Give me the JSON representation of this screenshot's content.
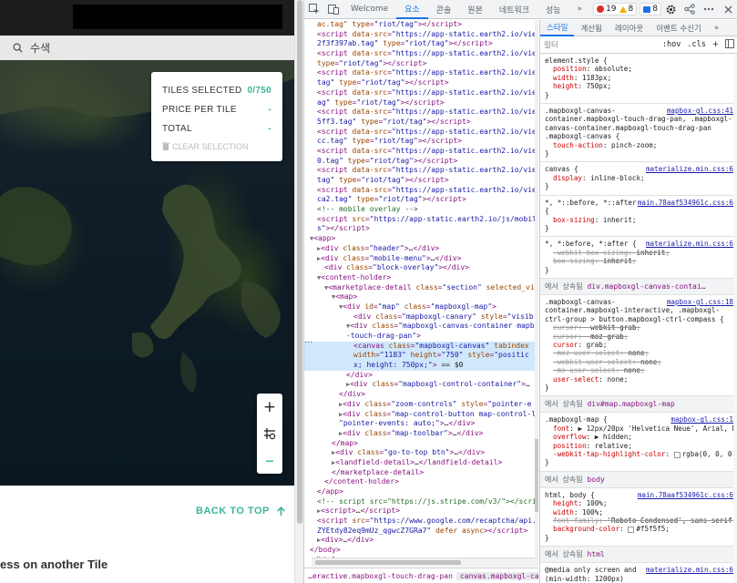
{
  "page": {
    "search_placeholder": "수색",
    "stats": {
      "tiles_selected_label": "TILES SELECTED",
      "tiles_selected_value": "0/750",
      "price_label": "PRICE PER TILE",
      "price_value": "-",
      "total_label": "TOTAL",
      "total_value": "-",
      "clear_label": "CLEAR SELECTION"
    },
    "zoom": {
      "plus": "+",
      "locate": "⌖",
      "minus": "–"
    },
    "back_to_top": "BACK TO TOP",
    "bottom_text": "ess on another Tile"
  },
  "devtools": {
    "tabs": [
      "Welcome",
      "요소",
      "콘솔",
      "원본",
      "네트워크",
      "성능",
      "»"
    ],
    "active_tab": "요소",
    "badges": {
      "errors": "19",
      "warnings": "8",
      "info": "8"
    },
    "elements_lines": [
      {
        "html": "<span class='an'>ac.tag\"</span> <span class='an'>type</span>=<span class='av'>\"riot/tag\"</span>&gt;&lt;/script&gt;",
        "i": 1
      },
      {
        "html": "&lt;script <span class='an'>data-src</span>=<span class='av'>\"https://app-static.earth2.io/vie</span>",
        "i": 1
      },
      {
        "html": "<span class='av'>2f3f397ab.tag\"</span> <span class='an'>type</span>=<span class='av'>\"riot/tag\"</span>&gt;&lt;/script&gt;",
        "i": 1
      },
      {
        "html": "&lt;script <span class='an'>data-src</span>=<span class='av'>\"https://app-static.earth2.io/vie</span>",
        "i": 1
      },
      {
        "html": "<span class='an'>type</span>=<span class='av'>\"riot/tag\"</span>&gt;&lt;/script&gt;",
        "i": 1
      },
      {
        "html": "&lt;script <span class='an'>data-src</span>=<span class='av'>\"https://app-static.earth2.io/vie</span>",
        "i": 1
      },
      {
        "html": "<span class='av'>tag\"</span> <span class='an'>type</span>=<span class='av'>\"riot/tag\"</span>&gt;&lt;/script&gt;",
        "i": 1
      },
      {
        "html": "&lt;script <span class='an'>data-src</span>=<span class='av'>\"https://app-static.earth2.io/vie</span>",
        "i": 1
      },
      {
        "html": "<span class='av'>ag\"</span> <span class='an'>type</span>=<span class='av'>\"riot/tag\"</span>&gt;&lt;/script&gt;",
        "i": 1
      },
      {
        "html": "&lt;script <span class='an'>data-src</span>=<span class='av'>\"https://app-static.earth2.io/vie</span>",
        "i": 1
      },
      {
        "html": "<span class='av'>5ff3.tag\"</span> <span class='an'>type</span>=<span class='av'>\"riot/tag\"</span>&gt;&lt;/script&gt;",
        "i": 1
      },
      {
        "html": "&lt;script <span class='an'>data-src</span>=<span class='av'>\"https://app-static.earth2.io/vie</span>",
        "i": 1
      },
      {
        "html": "<span class='av'>cc.tag\"</span> <span class='an'>type</span>=<span class='av'>\"riot/tag\"</span>&gt;&lt;/script&gt;",
        "i": 1
      },
      {
        "html": "&lt;script <span class='an'>data-src</span>=<span class='av'>\"https://app-static.earth2.io/vie</span>",
        "i": 1
      },
      {
        "html": "<span class='av'>0.tag\"</span> <span class='an'>type</span>=<span class='av'>\"riot/tag\"</span>&gt;&lt;/script&gt;",
        "i": 1
      },
      {
        "html": "&lt;script <span class='an'>data-src</span>=<span class='av'>\"https://app-static.earth2.io/vie</span>",
        "i": 1
      },
      {
        "html": "<span class='av'>tag\"</span> <span class='an'>type</span>=<span class='av'>\"riot/tag\"</span>&gt;&lt;/script&gt;",
        "i": 1
      },
      {
        "html": "&lt;script <span class='an'>data-src</span>=<span class='av'>\"https://app-static.earth2.io/vie</span>",
        "i": 1
      },
      {
        "html": "<span class='av'>ca2.tag\"</span> <span class='an'>type</span>=<span class='av'>\"riot/tag\"</span>&gt;&lt;/script&gt;",
        "i": 1
      },
      {
        "html": "<span class='cm'>&lt;!-- mobile overlay --&gt;</span>",
        "i": 1
      },
      {
        "html": "&lt;script <span class='an'>src</span>=<span class='av'>\"https://app-static.earth2.io/js/mobile</span>",
        "i": 1
      },
      {
        "html": "<span class='av'>s\"</span>&gt;&lt;/script&gt;",
        "i": 1
      },
      {
        "html": "<span class='arrow'>▼</span>&lt;app&gt;",
        "i": 0
      },
      {
        "html": "<span class='arrow'>▶</span>&lt;div <span class='an'>class</span>=<span class='av'>\"header\"</span>&gt;<span class='tx'>…</span>&lt;/div&gt;",
        "i": 1
      },
      {
        "html": "<span class='arrow'>▶</span>&lt;div <span class='an'>class</span>=<span class='av'>\"mobile-menu\"</span>&gt;<span class='tx'>…</span>&lt;/div&gt;",
        "i": 1
      },
      {
        "html": "&lt;div <span class='an'>class</span>=<span class='av'>\"block-overlay\"</span>&gt;&lt;/div&gt;",
        "i": 2
      },
      {
        "html": "<span class='arrow'>▼</span>&lt;content-holder&gt;",
        "i": 1
      },
      {
        "html": "<span class='arrow'>▼</span>&lt;marketplace-detail <span class='an'>class</span>=<span class='av'>\"section\"</span> <span class='an'>selected_vi</span>",
        "i": 2
      },
      {
        "html": "<span class='arrow'>▼</span>&lt;map&gt;",
        "i": 3
      },
      {
        "html": "<span class='arrow'>▼</span>&lt;div <span class='an'>id</span>=<span class='av'>\"map\"</span> <span class='an'>class</span>=<span class='av'>\"mapboxgl-map\"</span>&gt;",
        "i": 4
      },
      {
        "html": "&lt;div <span class='an'>class</span>=<span class='av'>\"mapboxgl-canary\"</span> <span class='an'>style</span>=<span class='av'>\"visib</span>",
        "i": 6
      },
      {
        "html": "<span class='arrow'>▼</span>&lt;div <span class='an'>class</span>=<span class='av'>\"mapboxgl-canvas-container mapb</span>",
        "i": 5
      },
      {
        "html": "<span class='av'>-touch-drag-pan\"</span>&gt;",
        "i": 5
      },
      {
        "html": "&lt;canvas <span class='an'>class</span>=<span class='av'>\"mapboxgl-canvas\"</span> <span class='an'>tabindex</span>",
        "i": 6,
        "sel": true
      },
      {
        "html": "<span class='an'>width</span>=<span class='av'>\"1183\"</span> <span class='an'>height</span>=<span class='av'>\"750\"</span> <span class='an'>style</span>=<span class='av'>\"positic</span>",
        "i": 6,
        "sel": true
      },
      {
        "html": "<span class='av'>x; height: 750px;\"</span>&gt; <span class='tx'>== $0</span>",
        "i": 6,
        "sel": true
      },
      {
        "html": "&lt;/div&gt;",
        "i": 5
      },
      {
        "html": "<span class='arrow'>▶</span>&lt;div <span class='an'>class</span>=<span class='av'>\"mapboxgl-control-container\"</span>&gt;<span class='tx'>…</span>",
        "i": 5
      },
      {
        "html": "&lt;/div&gt;",
        "i": 4
      },
      {
        "html": "<span class='arrow'>▶</span>&lt;div <span class='an'>class</span>=<span class='av'>\"zoom-controls\"</span> <span class='an'>style</span>=<span class='av'>\"pointer-e</span>",
        "i": 4
      },
      {
        "html": "<span class='arrow'>▶</span>&lt;div <span class='an'>class</span>=<span class='av'>\"map-control-button map-control-l</span>",
        "i": 4
      },
      {
        "html": "<span class='av'>\"pointer-events: auto;\"</span>&gt;<span class='tx'>…</span>&lt;/div&gt;",
        "i": 4
      },
      {
        "html": "<span class='arrow'>▶</span>&lt;div <span class='an'>class</span>=<span class='av'>\"map-toolbar\"</span>&gt;<span class='tx'>…</span>&lt;/div&gt;",
        "i": 4
      },
      {
        "html": "&lt;/map&gt;",
        "i": 3
      },
      {
        "html": "<span class='arrow'>▶</span>&lt;div <span class='an'>class</span>=<span class='av'>\"go-to-top btn\"</span>&gt;<span class='tx'>…</span>&lt;/div&gt;",
        "i": 3
      },
      {
        "html": "<span class='arrow'>▶</span>&lt;landfield-detail&gt;<span class='tx'>…</span>&lt;/landfield-detail&gt;",
        "i": 3
      },
      {
        "html": "&lt;/marketplace-detail&gt;",
        "i": 3
      },
      {
        "html": "&lt;/content-holder&gt;",
        "i": 2
      },
      {
        "html": "&lt;/app&gt;",
        "i": 1
      },
      {
        "html": "<span class='cm'>&lt;!-- script src=\"https://js.stripe.com/v3/\"&gt;&lt;/scrip</span>",
        "i": 1
      },
      {
        "html": "<span class='arrow'>▶</span>&lt;script&gt;<span class='tx'>…</span>&lt;/script&gt;",
        "i": 1
      },
      {
        "html": "&lt;script <span class='an'>src</span>=<span class='av'>\"https://www.google.com/recaptcha/api.j</span>",
        "i": 1
      },
      {
        "html": "<span class='av'>ZYEtdy82eq9mUz_qgwcZ7GRa7\"</span> <span class='an'>defer async</span>&gt;&lt;/script&gt;",
        "i": 1
      },
      {
        "html": "<span class='arrow'>▶</span>&lt;div&gt;<span class='tx'>…</span>&lt;/div&gt;",
        "i": 1
      },
      {
        "html": "&lt;/body&gt;",
        "i": 0
      },
      {
        "html": "&lt;/html&gt;",
        "i": 0
      }
    ],
    "elements_dots": "…",
    "breadcrumbs": [
      "…eractive.mapboxgl-touch-drag-pan",
      "canvas.mapboxgl-canvas",
      "…"
    ],
    "styles_tabs": [
      "스타일",
      "계산됨",
      "레이아웃",
      "이벤트 수신기",
      "»"
    ],
    "filter_placeholder": "필터",
    "filter_hov": ":hov",
    "filter_cls": ".cls",
    "filter_plus": "+",
    "inherit_prefix": "에서 상속됨",
    "rules": {
      "r1": {
        "selector": "element.style {",
        "props": [
          [
            "position",
            "absolute"
          ],
          [
            "width",
            "1183px"
          ],
          [
            "height",
            "750px"
          ]
        ]
      },
      "r2": {
        "src": "mapbox-gl.css:41",
        "selector": ".mapboxgl-canvas-container.mapboxgl-touch-drag-pan, .mapboxgl-canvas-container.mapboxgl-touch-drag-pan .mapboxgl-canvas {",
        "props": [
          [
            "touch-action",
            "pinch-zoom"
          ]
        ]
      },
      "r3": {
        "src": "materialize.min.css:6",
        "selector": "canvas {",
        "props": [
          [
            "display",
            "inline-block"
          ]
        ]
      },
      "r4": {
        "src": "main.78aaf534961c.css:6",
        "selector": "*, *::before, *::after {",
        "props": [
          [
            "box-sizing",
            "inherit"
          ]
        ]
      },
      "r5": {
        "src": "materialize.min.css:6",
        "selector": "*, *:before, *:after {",
        "props": [
          [
            "-webkit-box-sizing",
            "inherit"
          ],
          [
            "box-sizing",
            "inherit"
          ]
        ]
      },
      "h1": "div.mapboxgl-canvas-contai…",
      "r6": {
        "src": "mapbox-gl.css:18",
        "selector": ".mapboxgl-canvas-container.mapboxgl-interactive, .mapboxgl-ctrl-group > button.mapboxgl-ctrl-compass {",
        "props": [
          [
            "cursor",
            "-webkit-grab"
          ],
          [
            "cursor",
            "-moz-grab"
          ],
          [
            "cursor",
            "grab"
          ],
          [
            "-moz-user-select",
            "none"
          ],
          [
            "-webkit-user-select",
            "none"
          ],
          [
            "-ms-user-select",
            "none"
          ],
          [
            "user-select",
            "none"
          ]
        ]
      },
      "h2": "div#map.mapboxgl-map",
      "r7": {
        "src": "mapbox-gl.css:1",
        "selector": ".mapboxgl-map {",
        "props": [
          [
            "font",
            "▶ 12px/20px 'Helvetica Neue', Arial, Helvetica, sans-serif"
          ],
          [
            "overflow",
            "▶ hidden"
          ],
          [
            "position",
            "relative"
          ],
          [
            "-webkit-tap-highlight-color",
            "rgba(0, 0, 0, 0)"
          ]
        ]
      },
      "h3": "body",
      "r8": {
        "src": "main.78aaf534961c.css:6",
        "selector": "html, body {",
        "props": [
          [
            "height",
            "100%"
          ],
          [
            "width",
            "100%"
          ],
          [
            "font-family",
            "'Roboto Condensed', sans-serif"
          ],
          [
            "background-color",
            "#f5f5f5"
          ]
        ]
      },
      "h4": "html",
      "r9": {
        "src": "materialize.min.css:6",
        "selector": "@media only screen and (min-width: 1200px)",
        "selector2": "html {"
      }
    }
  }
}
